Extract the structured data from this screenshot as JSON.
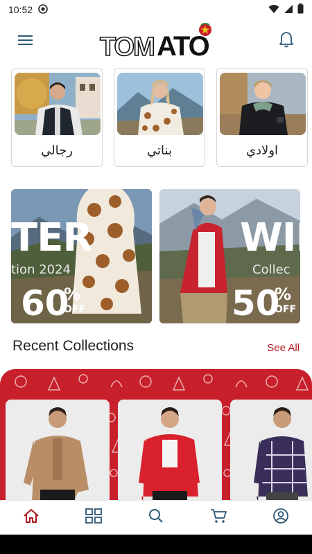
{
  "status_bar": {
    "time": "10:52",
    "icons": [
      "media-sync-icon",
      "wifi-icon",
      "signal-icon",
      "battery-icon"
    ]
  },
  "app_bar": {
    "logo_text": "TOMATO",
    "menu_icon": "hamburger-menu-icon",
    "notification_icon": "bell-icon"
  },
  "categories": [
    {
      "label": "رجالي",
      "image": "man-in-puffer-vest"
    },
    {
      "label": "بناتي",
      "image": "girl-in-bear-print-coat"
    },
    {
      "label": "اولادي",
      "image": "boy-in-black-jacket"
    }
  ],
  "banners": [
    {
      "headline": "TER",
      "subline": "tion 2024",
      "discount_value": "60",
      "discount_suffix": "OFF",
      "image": "teddy-coat-mountains"
    },
    {
      "headline": "WIN",
      "subline": "Collec",
      "discount_value": "50",
      "discount_suffix": "OFF",
      "image": "man-red-jacket-mountains"
    }
  ],
  "recent": {
    "title": "Recent Collections",
    "see_all": "See All"
  },
  "collections": [
    {
      "image": "man-beige-jacket"
    },
    {
      "image": "man-red-windbreaker"
    },
    {
      "image": "man-plaid-shirt"
    }
  ],
  "bottom_nav": [
    {
      "icon": "home-icon",
      "active": true
    },
    {
      "icon": "categories-grid-icon",
      "active": false
    },
    {
      "icon": "search-icon",
      "active": false
    },
    {
      "icon": "cart-icon",
      "active": false
    },
    {
      "icon": "account-icon",
      "active": false
    }
  ],
  "colors": {
    "brand_red": "#b01722",
    "nav_icon": "#2d5876",
    "collection_bg": "#c8202a"
  }
}
